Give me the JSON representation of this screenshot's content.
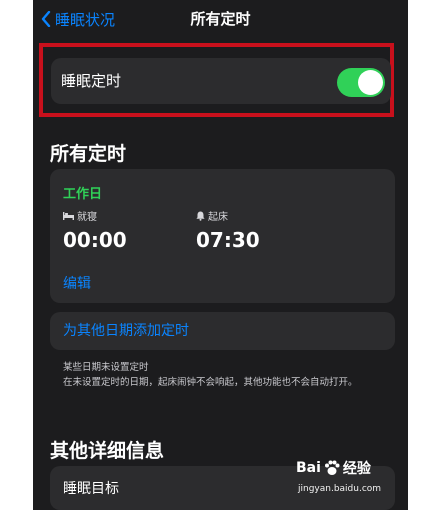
{
  "nav": {
    "back_label": "睡眠状况",
    "title": "所有定时"
  },
  "toggle": {
    "label": "睡眠定时",
    "state": "on",
    "color": "#30d158"
  },
  "schedules_section": {
    "header": "所有定时",
    "schedule": {
      "name": "工作日",
      "bedtime_label": "就寝",
      "bedtime_value": "00:00",
      "wake_label": "起床",
      "wake_value": "07:30",
      "edit_label": "编辑"
    },
    "add_label": "为其他日期添加定时"
  },
  "footnote": {
    "line1": "某些日期未设置定时",
    "line2": "在未设置定时的日期，起床闹钟不会响起，其他功能也不会自动打开。"
  },
  "details_section": {
    "header": "其他详细信息",
    "first_item": "睡眠目标"
  },
  "watermark": {
    "logo_text": "Bai",
    "logo_suffix": "经验",
    "url": "jingyan.baidu.com"
  },
  "colors": {
    "accent": "#0a84ff",
    "highlight_border": "#c8101c",
    "background": "#1c1c1e",
    "cell": "#2c2c2e"
  }
}
